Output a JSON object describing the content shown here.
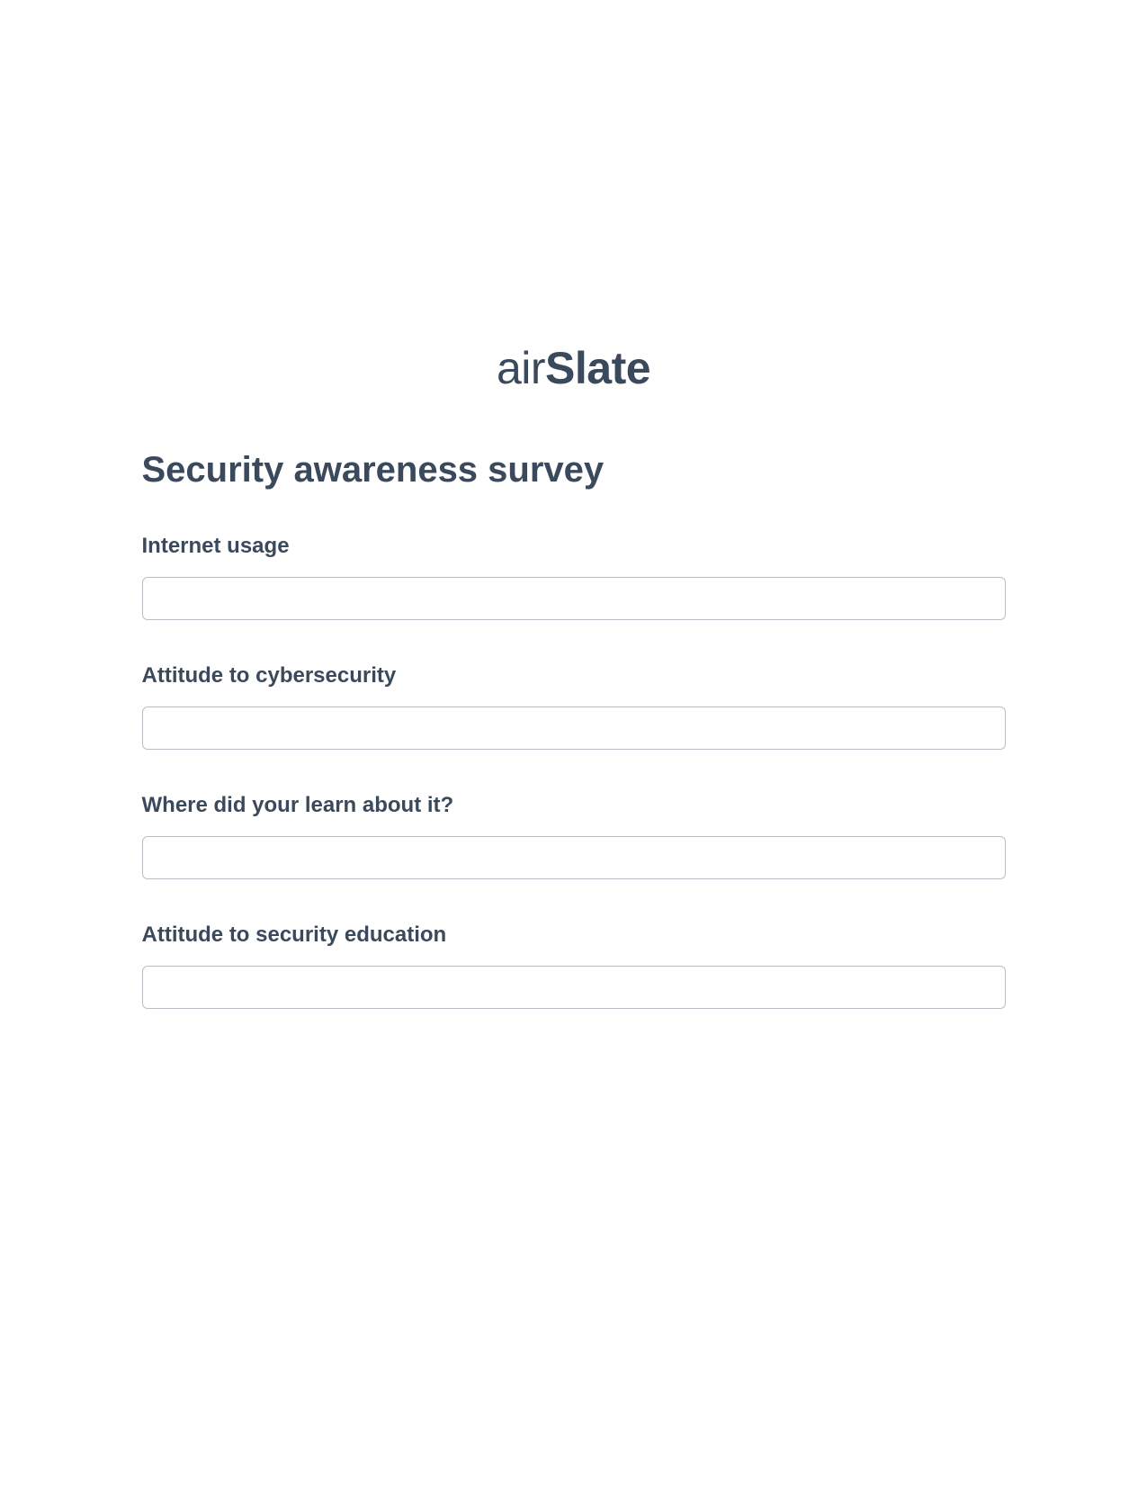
{
  "logo": {
    "part1": "air",
    "part2": "Slate"
  },
  "form": {
    "title": "Security awareness survey",
    "fields": [
      {
        "label": "Internet usage",
        "value": ""
      },
      {
        "label": "Attitude to cybersecurity",
        "value": ""
      },
      {
        "label": "Where did your learn about it?",
        "value": ""
      },
      {
        "label": "Attitude to security education",
        "value": ""
      }
    ]
  }
}
